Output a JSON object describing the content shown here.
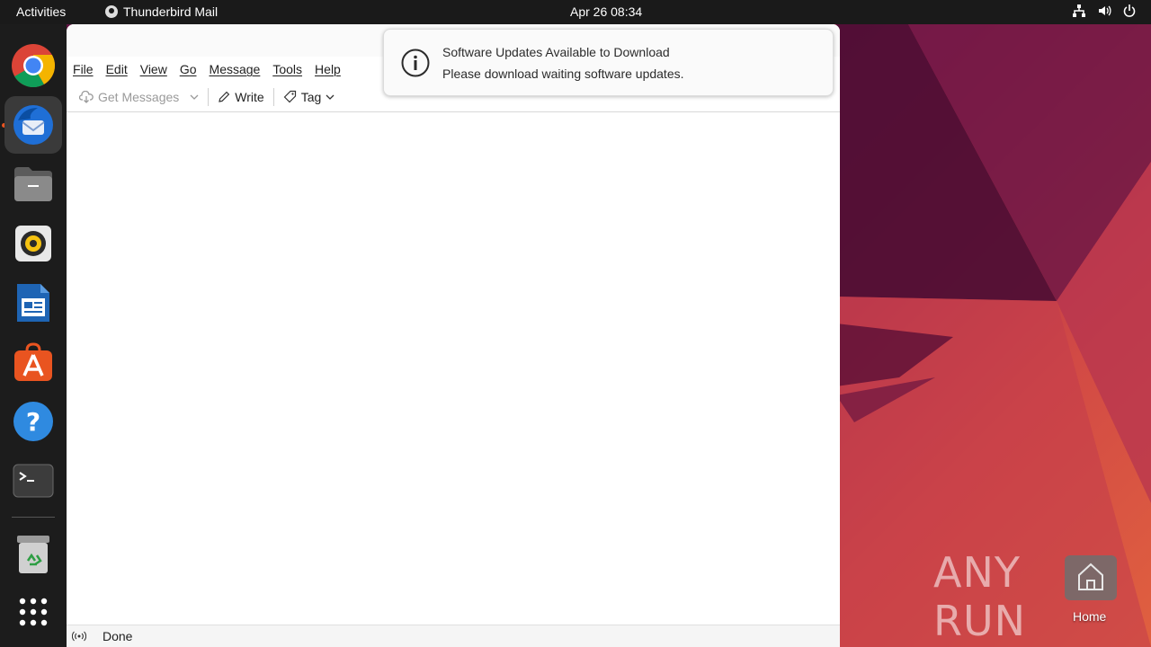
{
  "topbar": {
    "activities": "Activities",
    "app_name": "Thunderbird Mail",
    "clock": "Apr 26  08:34"
  },
  "dock": {
    "items": [
      "chrome-icon",
      "thunderbird-icon",
      "files-icon",
      "rhythmbox-icon",
      "writer-icon",
      "app-center-icon",
      "help-icon",
      "terminal-icon",
      "trash-icon",
      "app-grid-icon"
    ]
  },
  "window": {
    "menu": {
      "file": "File",
      "edit": "Edit",
      "view": "View",
      "go": "Go",
      "message": "Message",
      "tools": "Tools",
      "help": "Help"
    },
    "toolbar": {
      "get_messages": "Get Messages",
      "write": "Write",
      "tag": "Tag"
    },
    "status": {
      "text": "Done"
    }
  },
  "notification": {
    "title": "Software Updates Available to Download",
    "body": "Please download waiting software updates."
  },
  "desktop": {
    "home_label": "Home",
    "watermark": "ANY RUN"
  },
  "colors": {
    "accent": "#e95420",
    "topbar": "#1a1a1a",
    "dock": "#1c1c1c"
  }
}
